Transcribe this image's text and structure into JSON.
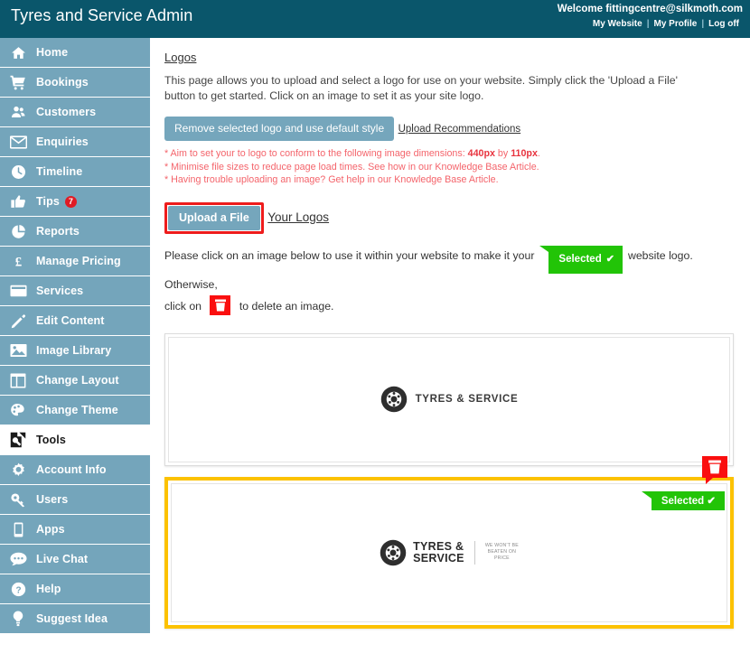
{
  "topbar": {
    "title": "Tyres and Service Admin",
    "welcome": "Welcome fittingcentre@silkmoth.com",
    "links": [
      {
        "label": "My Website"
      },
      {
        "label": "My Profile"
      },
      {
        "label": "Log off"
      }
    ],
    "separator": "|"
  },
  "sidebar": {
    "items": [
      {
        "label": "Home",
        "icon": "home-icon",
        "active": false
      },
      {
        "label": "Bookings",
        "icon": "cart-icon",
        "active": false
      },
      {
        "label": "Customers",
        "icon": "people-icon",
        "active": false
      },
      {
        "label": "Enquiries",
        "icon": "envelope-icon",
        "active": false
      },
      {
        "label": "Timeline",
        "icon": "clock-icon",
        "active": false
      },
      {
        "label": "Tips",
        "icon": "thumbs-up-icon",
        "active": false,
        "badge": "7"
      },
      {
        "label": "Reports",
        "icon": "pie-chart-icon",
        "active": false
      },
      {
        "label": "Manage Pricing",
        "icon": "pound-icon",
        "active": false
      },
      {
        "label": "Services",
        "icon": "card-icon",
        "active": false
      },
      {
        "label": "Edit Content",
        "icon": "pencil-icon",
        "active": false
      },
      {
        "label": "Image Library",
        "icon": "image-icon",
        "active": false
      },
      {
        "label": "Change Layout",
        "icon": "layout-icon",
        "active": false
      },
      {
        "label": "Change Theme",
        "icon": "paint-icon",
        "active": false
      },
      {
        "label": "Tools",
        "icon": "tools-icon",
        "active": true
      },
      {
        "label": "Account Info",
        "icon": "gear-icon",
        "active": false
      },
      {
        "label": "Users",
        "icon": "key-icon",
        "active": false
      },
      {
        "label": "Apps",
        "icon": "mobile-icon",
        "active": false
      },
      {
        "label": "Live Chat",
        "icon": "chat-icon",
        "active": false
      },
      {
        "label": "Help",
        "icon": "question-icon",
        "active": false
      },
      {
        "label": "Suggest Idea",
        "icon": "lightbulb-icon",
        "active": false
      }
    ]
  },
  "main": {
    "logos_heading": "Logos",
    "intro": "This page allows you to upload and select a logo for use on your website. Simply click the 'Upload a File' button to get started. Click on an image to set it as your site logo.",
    "remove_button": "Remove selected logo and use default style",
    "recommendations_heading": "Upload Recommendations",
    "recommendation_lines": [
      {
        "pre": "* Aim to set your to logo to conform to the following image dimensions: ",
        "b1": "440px",
        "mid": " by ",
        "b2": "110px",
        "post": "."
      },
      {
        "pre": "* Minimise file sizes to reduce page load times. See how in our Knowledge Base Article.",
        "b1": "",
        "mid": "",
        "b2": "",
        "post": ""
      },
      {
        "pre": "* Having trouble uploading an image? Get help in our Knowledge Base Article.",
        "b1": "",
        "mid": "",
        "b2": "",
        "post": ""
      }
    ],
    "upload_button": "Upload a File",
    "your_logos_heading": "Your Logos",
    "instruction_part1": "Please click on an image below to use it within your website to make it your",
    "selected_badge": "Selected",
    "selected_tick": "✔",
    "instruction_part2": "website logo. Otherwise,",
    "instruction_part3": "click on",
    "instruction_part4": "to delete an image.",
    "logos": [
      {
        "name": "tyres-and-service-logo",
        "brand_line1": "TYRES & SERVICE",
        "selected": false,
        "delete_label": "Delete"
      },
      {
        "name": "tyres-and-service-price-logo",
        "brand_line1": "TYRES &",
        "brand_line2": "SERVICE",
        "tagline_line1": "WE WON'T BE",
        "tagline_line2": "BEATEN ON",
        "tagline_line3": "PRICE",
        "selected": true,
        "selected_label": "Selected",
        "selected_tick": "✔"
      }
    ]
  },
  "colors": {
    "header": "#0a566b",
    "sidebar": "#74a5bb",
    "accent_button": "#75a6bc",
    "danger": "#fa0f0f",
    "success": "#22c407",
    "highlight_border": "#fcc200",
    "warning_text": "#f4646b"
  }
}
